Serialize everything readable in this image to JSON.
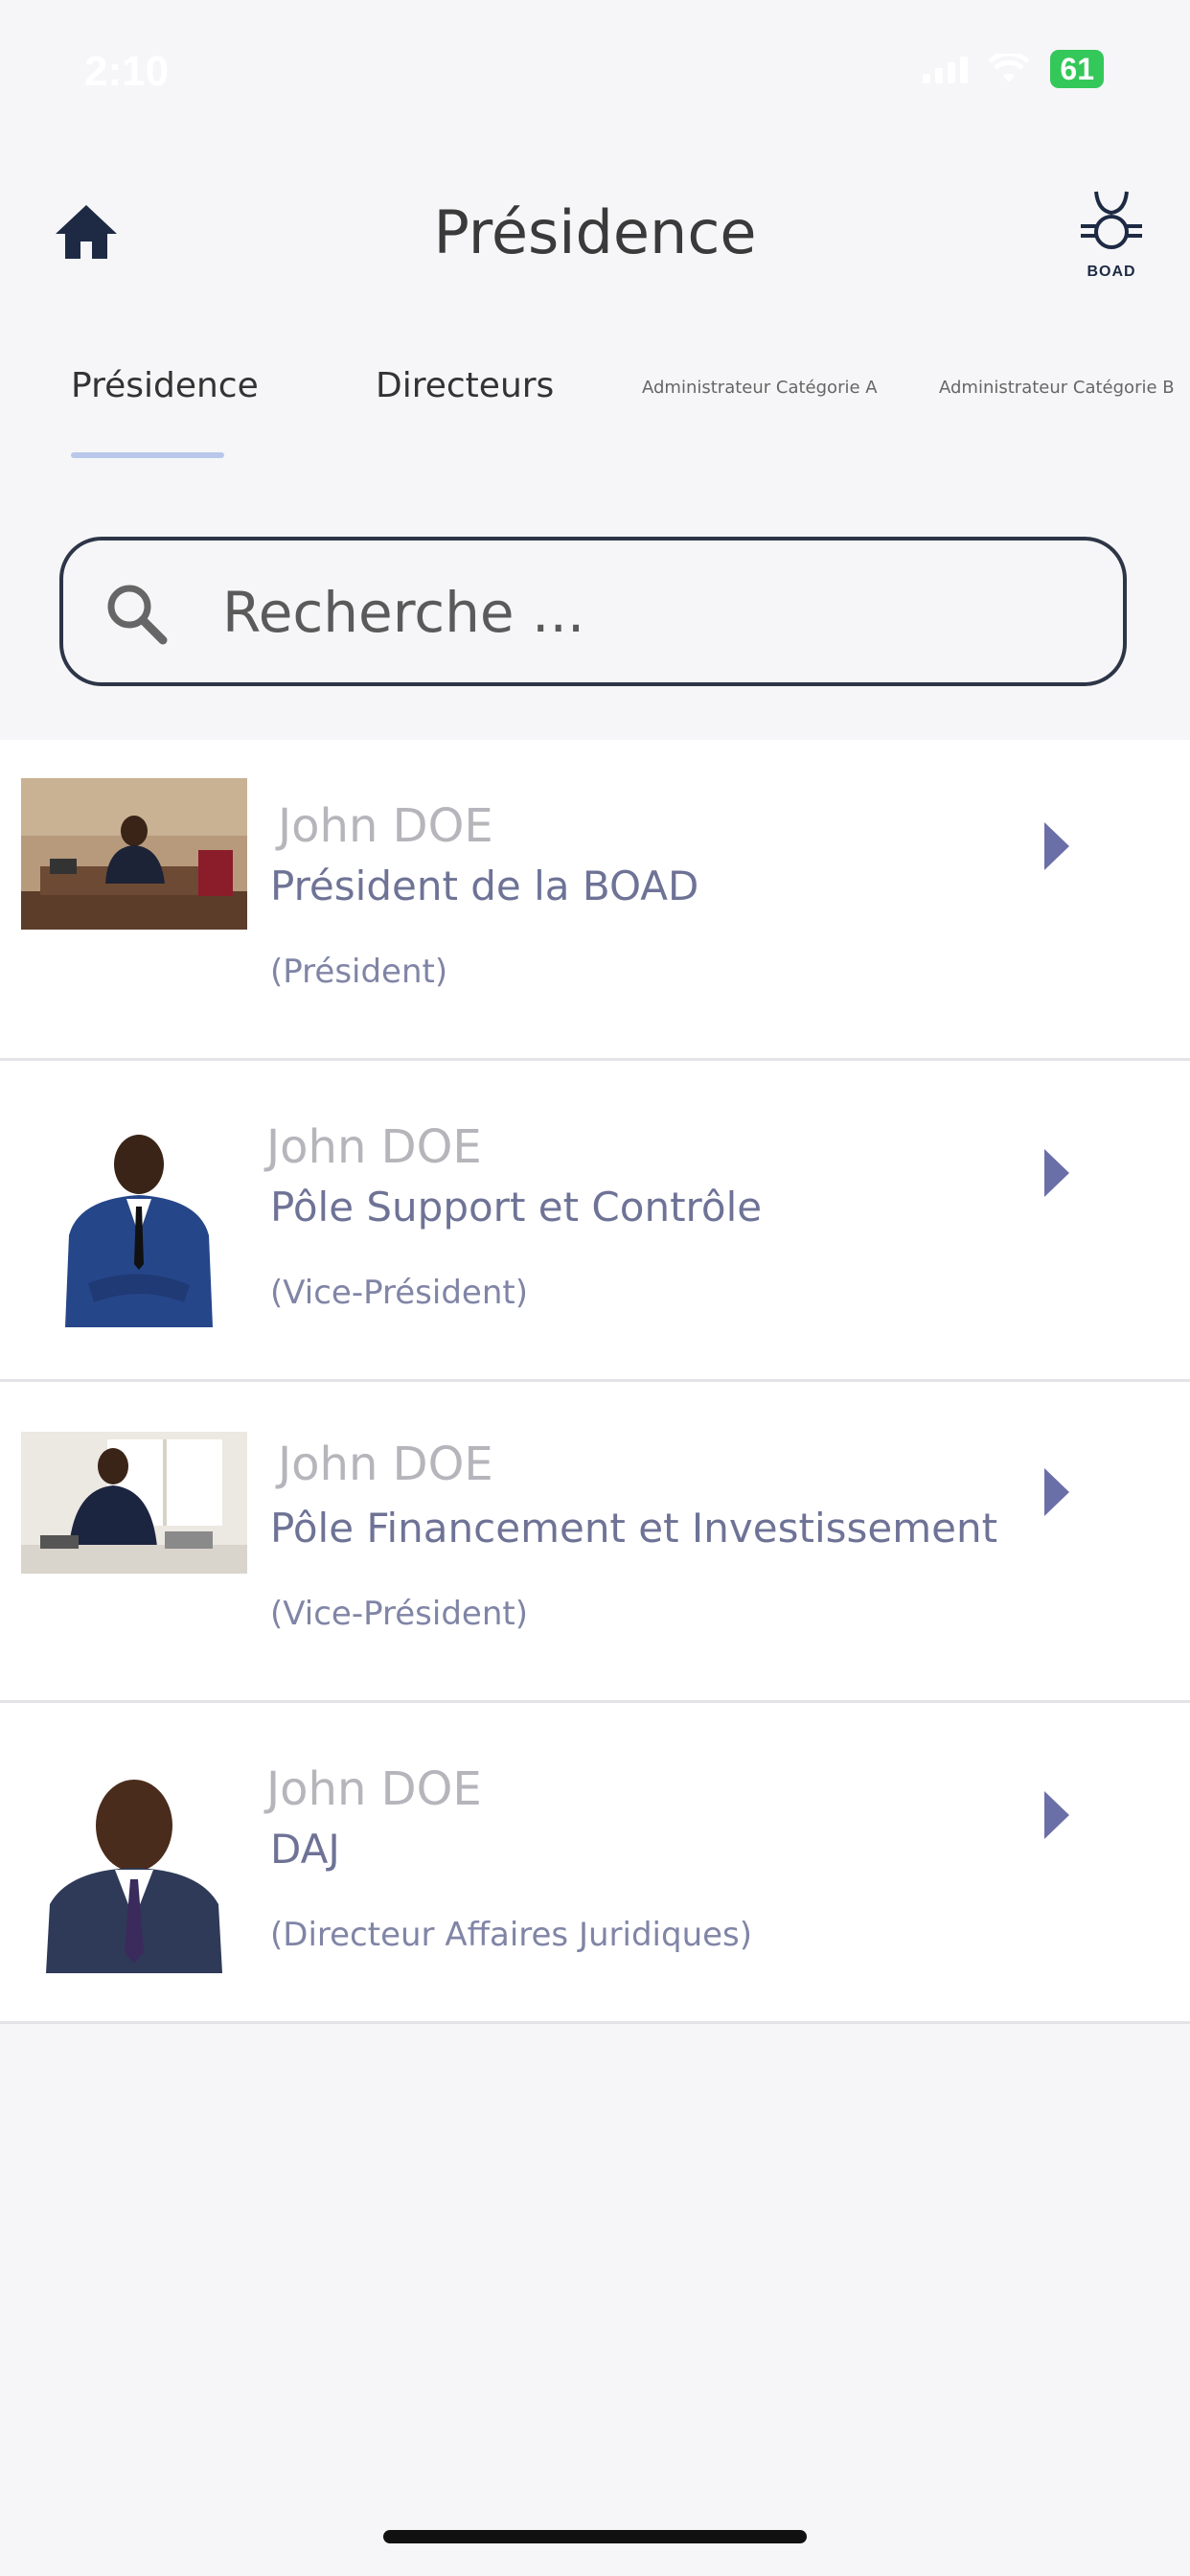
{
  "status_bar": {
    "time": "2:10",
    "battery": "61"
  },
  "header": {
    "title": "Présidence",
    "logo_text": "BOAD"
  },
  "tabs": [
    {
      "label": "Présidence"
    },
    {
      "label": "Directeurs"
    },
    {
      "label": "Administrateur Catégorie A"
    },
    {
      "label": "Administrateur Catégorie B"
    }
  ],
  "search": {
    "placeholder": "Recherche ..."
  },
  "people": [
    {
      "name": "John DOE",
      "role": "Président de la BOAD",
      "title": "(Président)"
    },
    {
      "name": "John DOE",
      "role": "Pôle Support et Contrôle",
      "title": "(Vice-Président)"
    },
    {
      "name": "John DOE",
      "role": "Pôle Financement et Investissement",
      "title": "(Vice-Président)"
    },
    {
      "name": "John DOE",
      "role": "DAJ",
      "title": "(Directeur Affaires Juridiques)"
    }
  ],
  "colors": {
    "accent": "#6e7396",
    "chevron": "#6b6fa8",
    "header_icon": "#1e2a44",
    "tab_underline": "#b9c8ea"
  },
  "icons": {
    "home": "home-icon",
    "logo": "boad-logo-icon",
    "search": "search-icon",
    "chevron": "chevron-right-icon"
  }
}
